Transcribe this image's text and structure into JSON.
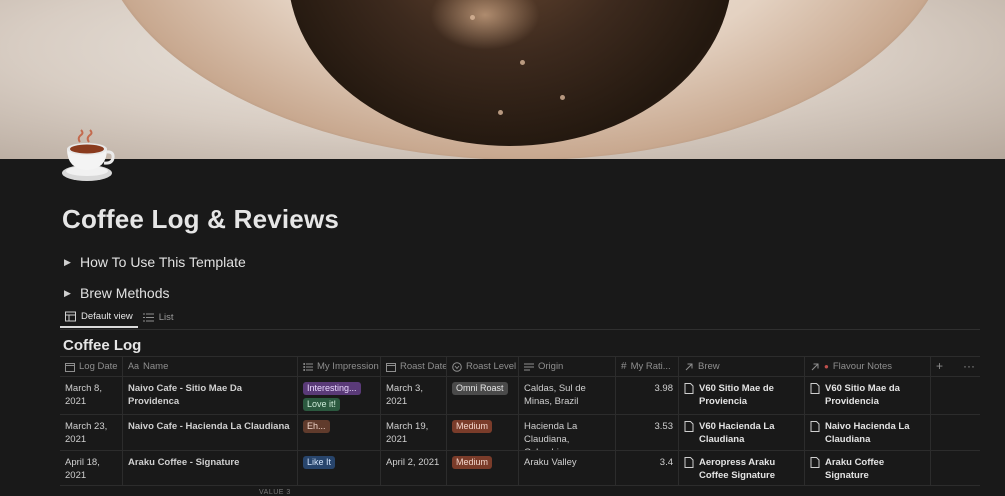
{
  "page": {
    "title": "Coffee Log & Reviews",
    "icon": "coffee-cup-icon"
  },
  "toggles": [
    {
      "label": "How To Use This Template"
    },
    {
      "label": "Brew Methods"
    }
  ],
  "views": [
    {
      "label": "Default view",
      "icon": "table-icon",
      "active": true
    },
    {
      "label": "List",
      "icon": "list-icon",
      "active": false
    }
  ],
  "database": {
    "title": "Coffee Log",
    "columns": [
      {
        "label": "Log Date",
        "icon": "calendar-icon"
      },
      {
        "label": "Name",
        "icon": "text-aa-icon"
      },
      {
        "label": "My Impression",
        "icon": "multi-select-icon"
      },
      {
        "label": "Roast Date",
        "icon": "calendar-icon"
      },
      {
        "label": "Roast Level",
        "icon": "select-icon"
      },
      {
        "label": "Origin",
        "icon": "text-lines-icon"
      },
      {
        "label": "My Rati...",
        "icon": "hash-icon"
      },
      {
        "label": "Brew",
        "icon": "relation-arrow-icon"
      },
      {
        "label": "Flavour Notes",
        "icon": "relation-arrow-icon"
      }
    ],
    "add_label": "+",
    "more_label": "···",
    "rows": [
      {
        "log_date": "March 8, 2021",
        "name": "Naivo Cafe - Sitio Mae Da Providenca",
        "impressions": [
          "Interesting...",
          "Love it!"
        ],
        "roast_date": "March 3, 2021",
        "roast_level": "Omni Roast",
        "origin": "Caldas, Sul de Minas, Brazil",
        "rating": "3.98",
        "brew": "V60 Sitio Mae de Proviencia",
        "flavour": "V60 Sitio Mae da Providencia"
      },
      {
        "log_date": "March 23, 2021",
        "name": "Naivo Cafe - Hacienda La Claudiana",
        "impressions": [
          "Eh..."
        ],
        "roast_date": "March 19, 2021",
        "roast_level": "Medium",
        "origin": "Hacienda La Claudiana, Colombia",
        "rating": "3.53",
        "brew": "V60 Hacienda La Claudiana",
        "flavour": "Naivo Hacienda La Claudiana"
      },
      {
        "log_date": "April 18, 2021",
        "name": "Araku Coffee - Signature",
        "impressions": [
          "Like It"
        ],
        "roast_date": "April 2, 2021",
        "roast_level": "Medium",
        "origin": "Araku Valley",
        "rating": "3.4",
        "brew": "Aeropress Araku Coffee Signature",
        "flavour": "Araku Coffee Signature"
      }
    ],
    "footer_hint": "VALUE 3"
  },
  "colors": {
    "background": "#191919",
    "tag_purple": "#5a3a78",
    "tag_green": "#2b593f",
    "tag_brown": "#603b2c",
    "tag_blue": "#28456c",
    "tag_gray": "#4a4a4a",
    "tag_rust": "#7a3c2a"
  }
}
